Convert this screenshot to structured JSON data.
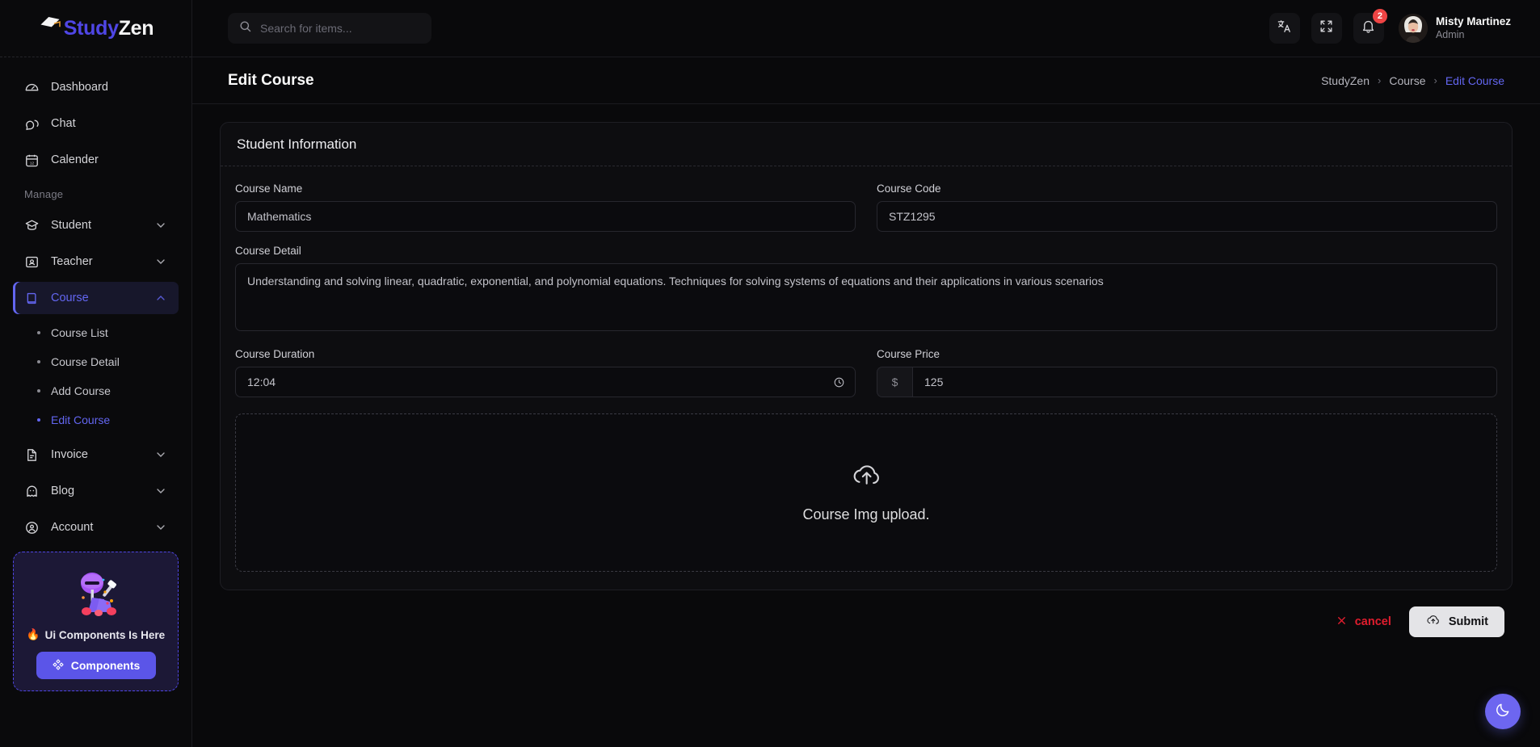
{
  "brand": {
    "part1": "Study",
    "part2": "Zen",
    "icon": "graduation-cap-icon"
  },
  "sidebar": {
    "items": [
      {
        "label": "Dashboard",
        "icon": "gauge-icon",
        "expandable": false
      },
      {
        "label": "Chat",
        "icon": "chat-bubble-icon",
        "expandable": false
      },
      {
        "label": "Calender",
        "icon": "calendar-icon",
        "expandable": false
      }
    ],
    "section_label": "Manage",
    "manage_items": [
      {
        "label": "Student",
        "icon": "graduation-cap-icon",
        "expandable": true,
        "active": false
      },
      {
        "label": "Teacher",
        "icon": "presentation-icon",
        "expandable": true,
        "active": false
      },
      {
        "label": "Course",
        "icon": "book-icon",
        "expandable": true,
        "active": true
      },
      {
        "label": "Invoice",
        "icon": "file-text-icon",
        "expandable": true,
        "active": false
      },
      {
        "label": "Blog",
        "icon": "ghost-icon",
        "expandable": true,
        "active": false
      },
      {
        "label": "Account",
        "icon": "user-circle-icon",
        "expandable": true,
        "active": false
      }
    ],
    "course_children": [
      {
        "label": "Course List",
        "active": false
      },
      {
        "label": "Course Detail",
        "active": false
      },
      {
        "label": "Add Course",
        "active": false
      },
      {
        "label": "Edit Course",
        "active": true
      }
    ],
    "promo": {
      "title": "Ui Components Is Here",
      "emoji": "🔥",
      "button_label": "Components",
      "accent": "#5b55e8"
    }
  },
  "topbar": {
    "search_placeholder": "Search for items...",
    "search_value": "",
    "translate_icon": "translate-icon",
    "fullscreen_icon": "fullscreen-icon",
    "notification_icon": "bell-icon",
    "notification_count": "2",
    "user": {
      "name": "Misty Martinez",
      "role": "Admin"
    }
  },
  "pagehead": {
    "title": "Edit Course",
    "breadcrumb": [
      {
        "label": "StudyZen",
        "current": false
      },
      {
        "label": "Course",
        "current": false
      },
      {
        "label": "Edit Course",
        "current": true
      }
    ],
    "separator": "›"
  },
  "form": {
    "card_title": "Student Information",
    "course_name": {
      "label": "Course Name",
      "value": "Mathematics",
      "placeholder": "Course Name"
    },
    "course_code": {
      "label": "Course Code",
      "value": "STZ1295",
      "placeholder": "Course Code"
    },
    "course_detail": {
      "label": "Course Detail",
      "value": "Understanding and solving linear, quadratic, exponential, and polynomial equations. Techniques for solving systems of equations and their applications in various scenarios"
    },
    "course_duration": {
      "label": "Course Duration",
      "value": "12:04",
      "icon": "clock-icon"
    },
    "course_price": {
      "label": "Course Price",
      "value": "125",
      "currency": "$"
    },
    "upload": {
      "text": "Course Img upload.",
      "icon": "cloud-upload-icon"
    },
    "cancel_label": "cancel",
    "submit_label": "Submit",
    "cancel_icon": "x-icon",
    "submit_icon": "cloud-upload-icon",
    "cancel_color": "#e11d2e"
  },
  "fab": {
    "icon": "moon-icon",
    "color": "#6d66f0"
  }
}
